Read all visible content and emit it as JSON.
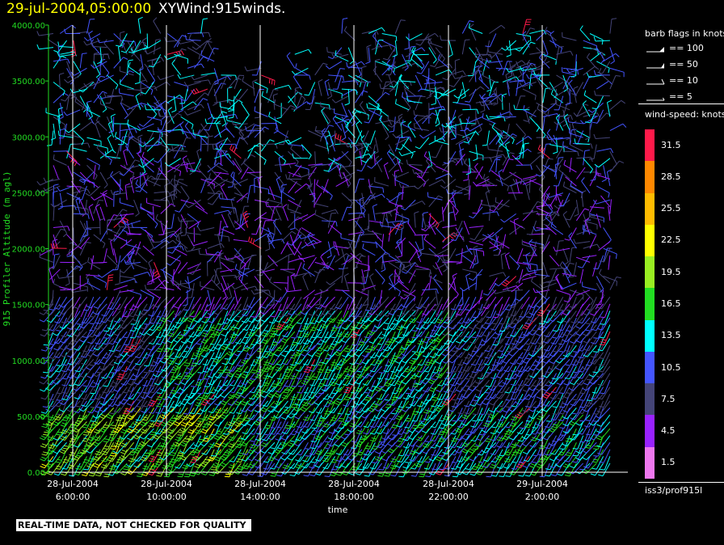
{
  "header": {
    "timestamp": "29-jul-2004,05:00:00",
    "title": "XYWind:915winds."
  },
  "chart_data": {
    "type": "wind-barb time-height",
    "ylabel": "915 Profiler Altitude (m agl)",
    "xlabel": "time",
    "ylim": [
      0,
      4000
    ],
    "yticks": [
      "0.00",
      "500.00",
      "1000.00",
      "1500.00",
      "2000.00",
      "2500.00",
      "3000.00",
      "3500.00",
      "4000.00"
    ],
    "xticks": [
      {
        "date": "28-Jul-2004",
        "time": "6:00:00"
      },
      {
        "date": "28-Jul-2004",
        "time": "10:00:00"
      },
      {
        "date": "28-Jul-2004",
        "time": "14:00:00"
      },
      {
        "date": "28-Jul-2004",
        "time": "18:00:00"
      },
      {
        "date": "28-Jul-2004",
        "time": "22:00:00"
      },
      {
        "date": "29-Jul-2004",
        "time": "2:00:00"
      }
    ],
    "vertical_grid": true,
    "colors": {
      "axis": "#22dd22",
      "grid": "#ffffff"
    }
  },
  "legend": {
    "flags_title": "barb flags in knots",
    "flags": [
      {
        "label": "== 100"
      },
      {
        "label": "== 50"
      },
      {
        "label": "== 10"
      },
      {
        "label": "== 5"
      }
    ],
    "speed_title": "wind-speed: knots",
    "speed_bins": [
      {
        "label": "31.5",
        "color": "#ff1a4a"
      },
      {
        "label": "28.5",
        "color": "#ff8800"
      },
      {
        "label": "25.5",
        "color": "#ffbb00"
      },
      {
        "label": "22.5",
        "color": "#ffff00"
      },
      {
        "label": "19.5",
        "color": "#99ee22"
      },
      {
        "label": "16.5",
        "color": "#22dd22"
      },
      {
        "label": "13.5",
        "color": "#00ffff"
      },
      {
        "label": "10.5",
        "color": "#4455ff"
      },
      {
        "label": "7.5",
        "color": "#444477"
      },
      {
        "label": "4.5",
        "color": "#9922ff"
      },
      {
        "label": "1.5",
        "color": "#ee77ee"
      }
    ],
    "source": "iss3/prof915l"
  },
  "footer": {
    "warning": "REAL-TIME DATA, NOT CHECKED FOR QUALITY"
  }
}
